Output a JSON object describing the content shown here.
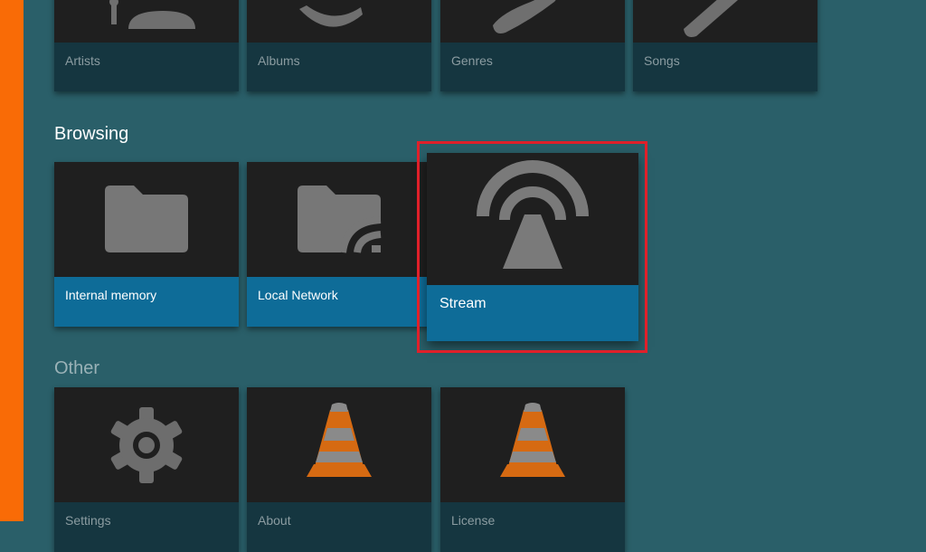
{
  "top_row": {
    "items": [
      {
        "label": "Artists",
        "icon": "artist-icon"
      },
      {
        "label": "Albums",
        "icon": "album-icon"
      },
      {
        "label": "Genres",
        "icon": "genre-icon"
      },
      {
        "label": "Songs",
        "icon": "song-icon"
      }
    ]
  },
  "browsing": {
    "title": "Browsing",
    "items": [
      {
        "label": "Internal memory",
        "icon": "folder-icon"
      },
      {
        "label": "Local Network",
        "icon": "network-folder-icon"
      },
      {
        "label": "Stream",
        "icon": "stream-icon"
      }
    ]
  },
  "other": {
    "title": "Other",
    "items": [
      {
        "label": "Settings",
        "icon": "gear-icon"
      },
      {
        "label": "About",
        "icon": "vlc-cone-icon"
      },
      {
        "label": "License",
        "icon": "vlc-cone-icon"
      }
    ]
  },
  "colors": {
    "background": "#2a5f69",
    "accent_stripe": "#f96b06",
    "card_label_active": "#0e6c98",
    "focus_ring": "#e0202a"
  }
}
